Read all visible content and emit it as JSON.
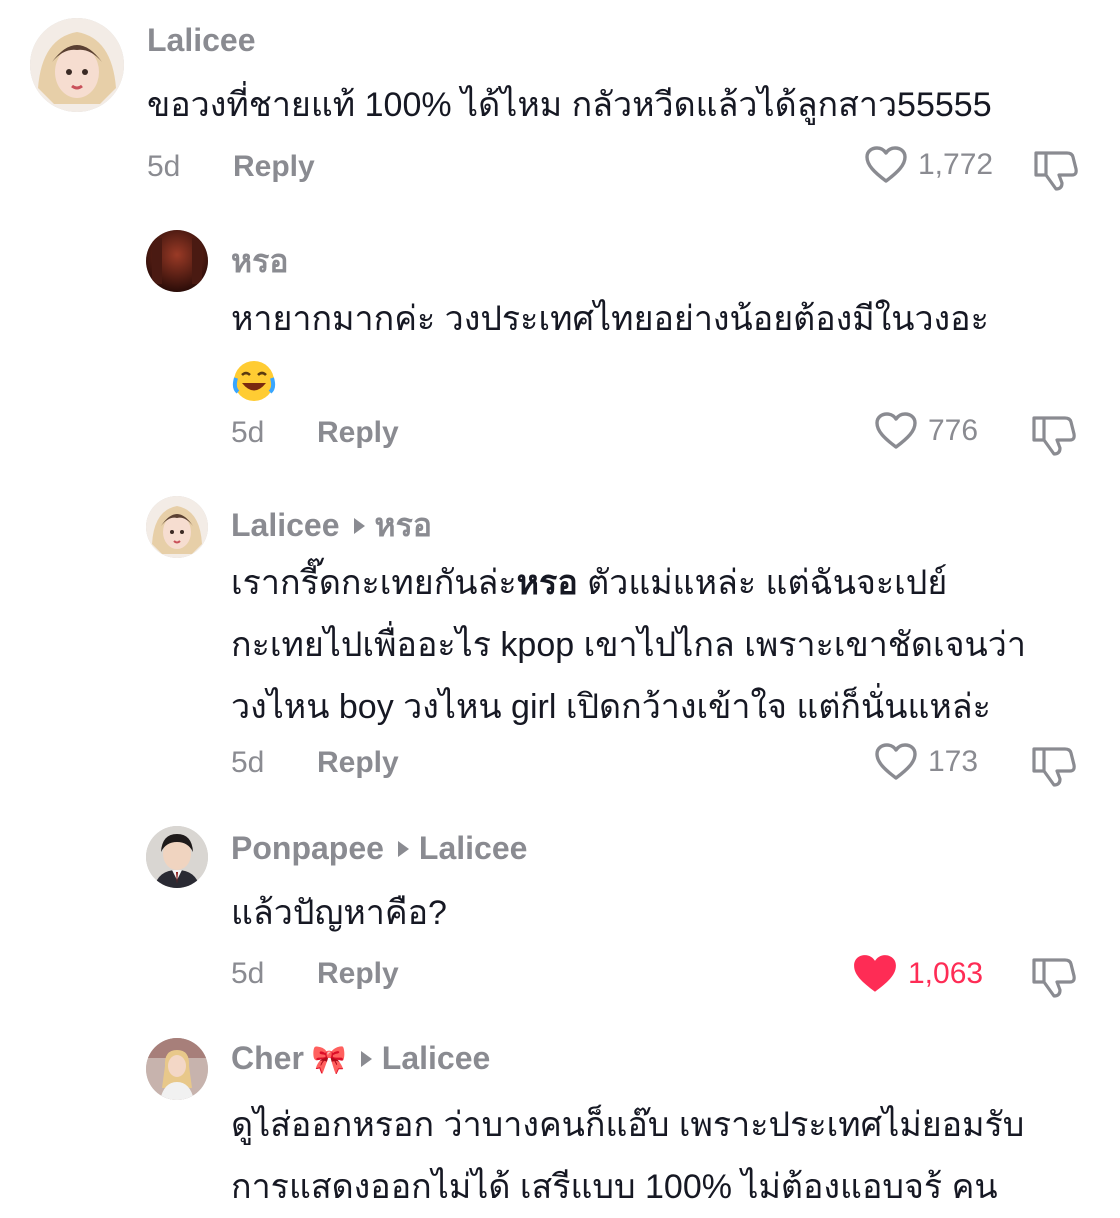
{
  "comments": [
    {
      "author": "Lalicee",
      "reply_to": "",
      "text": "ขอวงที่ชายแท้ 100% ได้ไหม กลัวหวีดแล้วได้ลูกสาว55555",
      "time": "5d",
      "reply_label": "Reply",
      "likes": "1,772",
      "liked": false
    },
    {
      "author": "หรอ",
      "reply_to": "",
      "text": "หายากมากค่ะ วงประเทศไทยอย่างน้อยต้องมีในวงอะ",
      "emoji": "😂",
      "time": "5d",
      "reply_label": "Reply",
      "likes": "776",
      "liked": false
    },
    {
      "author": "Lalicee",
      "reply_to": "หรอ",
      "text_pre": "เรากรี๊ดกะเทยกันล่ะ",
      "text_bold": "หรอ",
      "text_lines": [
        " ตัวแม่แหล่ะ แต่ฉันจะเปย์",
        "กะเทยไปเพื่ออะไร kpop เขาไปไกล เพราะเขาชัดเจนว่า",
        "วงไหน boy วงไหน girl เปิดกว้างเข้าใจ แต่ก็นั่นแหล่ะ"
      ],
      "time": "5d",
      "reply_label": "Reply",
      "likes": "173",
      "liked": false
    },
    {
      "author": "Ponpapee",
      "reply_to": "Lalicee",
      "text": "แล้วปัญหาคือ?",
      "time": "5d",
      "reply_label": "Reply",
      "likes": "1,063",
      "liked": true
    },
    {
      "author": "Cher",
      "author_emoji": "🎀",
      "reply_to": "Lalicee",
      "text_lines": [
        "ดูไส่ออกหรอก ว่าบางคนก็แอ๊บ เพราะประเทศไม่ยอมรับ",
        "การแสดงออกไม่ได้ เสรีแบบ 100% ไม่ต้องแอบจร้ คน"
      ]
    }
  ],
  "colors": {
    "accent_like": "#fe2c55",
    "muted": "#8a8b91",
    "text": "#161823"
  },
  "icons": {
    "like": "heart-outline-icon",
    "liked": "heart-filled-icon",
    "dislike": "thumbs-down-icon"
  }
}
